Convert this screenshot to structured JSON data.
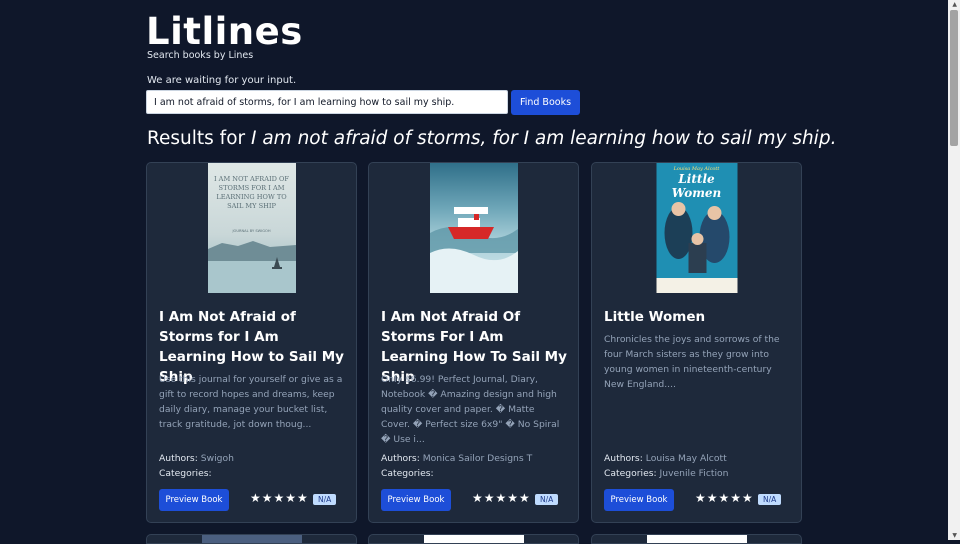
{
  "app": {
    "brand": "Litlines",
    "tagline": "Search books by Lines",
    "status": "We are waiting for your input."
  },
  "search": {
    "value": "I am not afraid of storms, for I am learning how to sail my ship.",
    "button_label": "Find Books"
  },
  "results": {
    "prefix": "Results for ",
    "query": "I am not afraid of storms, for I am learning how to sail my ship."
  },
  "books": [
    {
      "title": "I Am Not Afraid of Storms for I Am Learning How to Sail My Ship",
      "description": "Use this journal for yourself or give as a gift to record hopes and dreams, keep daily diary, manage your bucket list, track gratitude, jot down thoug...",
      "authors_label": "Authors:",
      "authors": "Swigoh",
      "categories_label": "Categories:",
      "categories": "",
      "preview_label": "Preview Book",
      "rating": 5,
      "badge": "N/A",
      "cover_text": "I AM NOT AFRAID OF STORMS FOR I AM LEARNING HOW TO SAIL MY SHIP",
      "cover_small": "JOURNAL BY SWIGOH"
    },
    {
      "title": "I Am Not Afraid Of Storms For I Am Learning How To Sail My Ship",
      "description": "Only $6.99! Perfect Journal, Diary, Notebook � Amazing design and high quality cover and paper. � Matte Cover. � Perfect size 6x9\" � No Spiral � Use i...",
      "authors_label": "Authors:",
      "authors": "Monica Sailor Designs T",
      "categories_label": "Categories:",
      "categories": "",
      "preview_label": "Preview Book",
      "rating": 5,
      "badge": "N/A"
    },
    {
      "title": "Little Women",
      "description": "Chronicles the joys and sorrows of the four March sisters as they grow into young women in nineteenth-century New England....",
      "authors_label": "Authors:",
      "authors": "Louisa May Alcott",
      "categories_label": "Categories:",
      "categories": "Juvenile Fiction",
      "preview_label": "Preview Book",
      "rating": 5,
      "badge": "N/A",
      "cover_author": "Louisa May Alcott",
      "cover_title": "Little Women"
    }
  ],
  "rating_stars": "★★★★★",
  "colors": {
    "background": "#0f172a",
    "card": "#1e293b",
    "accent": "#1d4ed8",
    "badge_bg": "#bfdbfe"
  }
}
